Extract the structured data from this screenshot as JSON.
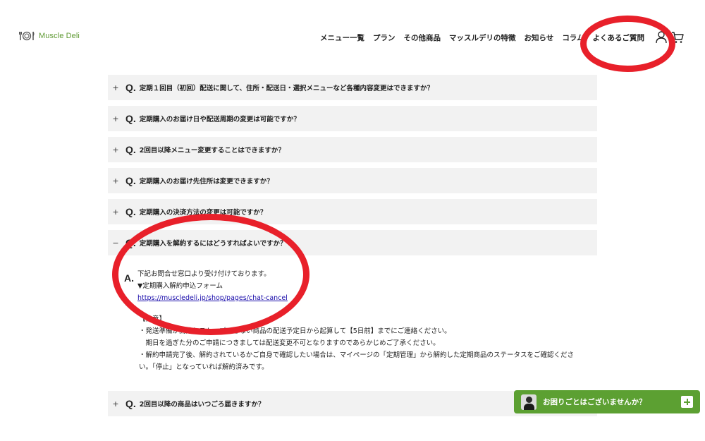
{
  "brand": {
    "name": "Muscle Deli",
    "accent": "#5f9a33"
  },
  "nav": {
    "items": [
      "メニュー一覧",
      "プラン",
      "その他商品",
      "マッスルデリの特徴",
      "お知らせ",
      "コラム",
      "よくあるご質問"
    ]
  },
  "header_icons": [
    "account-icon",
    "cart-icon"
  ],
  "faq": {
    "q_marker": "Q.",
    "a_marker": "A.",
    "items": [
      {
        "toggle": "+",
        "question": "定期１回目（初回）配送に関して、住所・配送日・選択メニューなど各種内容変更はできますか？"
      },
      {
        "toggle": "+",
        "question": "定期購入のお届け日や配送周期の変更は可能ですか？"
      },
      {
        "toggle": "+",
        "question": "2回目以降メニュー変更することはできますか？"
      },
      {
        "toggle": "+",
        "question": "定期購入のお届け先住所は変更できますか？"
      },
      {
        "toggle": "+",
        "question": "定期購入の決済方法の変更は可能ですか？"
      },
      {
        "toggle": "−",
        "question": "定期購入を解約するにはどうすればよいですか？"
      },
      {
        "toggle": "+",
        "question": "2回目以降の商品はいつごろ届きますか？"
      }
    ],
    "answer": {
      "line1": "下記お問合せ窓口より受け付けております。",
      "line2": "▼定期購入解約申込フォーム",
      "link": "https://muscledeli.jp/shop/pages/chat-cancel",
      "note_title": "【注意】",
      "note_lines": [
        "・発送準備が開始しストップできない商品の配送予定日から起算して【5日前】までにご連絡ください。",
        "　期日を過ぎた分のご申請につきましては配送変更不可となりますのであらかじめご了承ください。",
        "・解約申請完了後、解約されているかご自身で確認したい場合は、マイページの「定期管理」から解約した定期商品のステータスをご確認くださ",
        "い。「停止」となっていれば解約済みです。"
      ]
    }
  },
  "chat_widget": {
    "label": "お困りごとはございませんか？",
    "background": "#5ca032"
  },
  "annotation_color": "#e8202a"
}
